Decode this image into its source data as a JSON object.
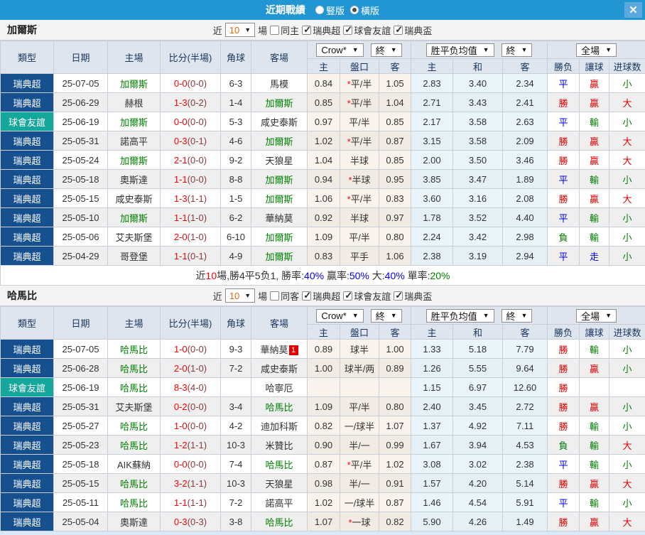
{
  "titlebar": {
    "title": "近期戰績",
    "radio_vertical": "豎版",
    "radio_horizontal": "橫版",
    "close_icon": "✕"
  },
  "colors": {
    "topbar": "#2196D3",
    "league_super": "#17508F",
    "league_friendly": "#16A79C",
    "win_red": "#E00000",
    "draw_blue": "#0000E0",
    "lose_green": "#008000",
    "score_red": "#FF0000",
    "half_maroon": "#8B3A3A",
    "odds_col_bg": "#FAF3EB",
    "avg_col_bg": "#E9F4FB",
    "header_bg": "#DFE5EF"
  },
  "columns": {
    "type": "類型",
    "date": "日期",
    "home": "主場",
    "score": "比分(半場)",
    "corners": "角球",
    "away": "客場",
    "odds_home": "主",
    "handicap": "盤口",
    "odds_away": "客",
    "avg_home": "主",
    "avg_draw": "和",
    "avg_away": "客",
    "result": "勝负",
    "handicap_result": "讓球",
    "goals": "进球数"
  },
  "dropdowns": {
    "company": "Crow*",
    "final1": "終",
    "avg": "胜平负均值",
    "final2": "終",
    "scope": "全場",
    "caret": "▼"
  },
  "sections": [
    {
      "team": "加爾斯",
      "filter": {
        "near_label": "近",
        "count": "10",
        "matches_label": "場",
        "same_label": "同主",
        "leagues": [
          {
            "label": "瑞典超"
          },
          {
            "label": "球會友誼"
          },
          {
            "label": "瑞典盃"
          }
        ]
      },
      "rows": [
        {
          "league": "瑞典超",
          "league_type": "super",
          "date": "25-07-05",
          "home": "加爾斯",
          "home_green": true,
          "score": "0-0",
          "half": "(0-0)",
          "corners": "6-3",
          "away": "馬模",
          "away_green": false,
          "odds_home": "0.84",
          "handicap_star": true,
          "handicap": "平/半",
          "odds_away": "1.05",
          "avg_home": "2.83",
          "avg_draw": "3.40",
          "avg_away": "2.34",
          "result": "平",
          "result_c": "blue",
          "hres": "贏",
          "hres_c": "red",
          "goals": "小",
          "goals_c": "green"
        },
        {
          "league": "瑞典超",
          "league_type": "super",
          "date": "25-06-29",
          "home": "赫根",
          "home_green": false,
          "score": "1-3",
          "half": "(0-2)",
          "corners": "1-4",
          "away": "加爾斯",
          "away_green": true,
          "odds_home": "0.85",
          "handicap_star": true,
          "handicap": "平/半",
          "odds_away": "1.04",
          "avg_home": "2.71",
          "avg_draw": "3.43",
          "avg_away": "2.41",
          "result": "勝",
          "result_c": "red",
          "hres": "贏",
          "hres_c": "red",
          "goals": "大",
          "goals_c": "red"
        },
        {
          "league": "球會友誼",
          "league_type": "friendly",
          "date": "25-06-19",
          "home": "加爾斯",
          "home_green": true,
          "score": "0-0",
          "half": "(0-0)",
          "corners": "5-3",
          "away": "咸史泰斯",
          "away_green": false,
          "odds_home": "0.97",
          "handicap_star": false,
          "handicap": "平/半",
          "odds_away": "0.85",
          "avg_home": "2.17",
          "avg_draw": "3.58",
          "avg_away": "2.63",
          "result": "平",
          "result_c": "blue",
          "hres": "輸",
          "hres_c": "green",
          "goals": "小",
          "goals_c": "green"
        },
        {
          "league": "瑞典超",
          "league_type": "super",
          "date": "25-05-31",
          "home": "諾高平",
          "home_green": false,
          "score": "0-3",
          "half": "(0-1)",
          "corners": "4-6",
          "away": "加爾斯",
          "away_green": true,
          "odds_home": "1.02",
          "handicap_star": true,
          "handicap": "平/半",
          "odds_away": "0.87",
          "avg_home": "3.15",
          "avg_draw": "3.58",
          "avg_away": "2.09",
          "result": "勝",
          "result_c": "red",
          "hres": "贏",
          "hres_c": "red",
          "goals": "大",
          "goals_c": "red"
        },
        {
          "league": "瑞典超",
          "league_type": "super",
          "date": "25-05-24",
          "home": "加爾斯",
          "home_green": true,
          "score": "2-1",
          "half": "(0-0)",
          "corners": "9-2",
          "away": "天狼星",
          "away_green": false,
          "odds_home": "1.04",
          "handicap_star": false,
          "handicap": "半球",
          "odds_away": "0.85",
          "avg_home": "2.00",
          "avg_draw": "3.50",
          "avg_away": "3.46",
          "result": "勝",
          "result_c": "red",
          "hres": "贏",
          "hres_c": "red",
          "goals": "大",
          "goals_c": "red"
        },
        {
          "league": "瑞典超",
          "league_type": "super",
          "date": "25-05-18",
          "home": "奧斯達",
          "home_green": false,
          "score": "1-1",
          "half": "(0-0)",
          "corners": "8-8",
          "away": "加爾斯",
          "away_green": true,
          "odds_home": "0.94",
          "handicap_star": true,
          "handicap": "半球",
          "odds_away": "0.95",
          "avg_home": "3.85",
          "avg_draw": "3.47",
          "avg_away": "1.89",
          "result": "平",
          "result_c": "blue",
          "hres": "輸",
          "hres_c": "green",
          "goals": "小",
          "goals_c": "green"
        },
        {
          "league": "瑞典超",
          "league_type": "super",
          "date": "25-05-15",
          "home": "咸史泰斯",
          "home_green": false,
          "score": "1-3",
          "half": "(1-1)",
          "corners": "1-5",
          "away": "加爾斯",
          "away_green": true,
          "odds_home": "1.06",
          "handicap_star": true,
          "handicap": "平/半",
          "odds_away": "0.83",
          "avg_home": "3.60",
          "avg_draw": "3.16",
          "avg_away": "2.08",
          "result": "勝",
          "result_c": "red",
          "hres": "贏",
          "hres_c": "red",
          "goals": "大",
          "goals_c": "red"
        },
        {
          "league": "瑞典超",
          "league_type": "super",
          "date": "25-05-10",
          "home": "加爾斯",
          "home_green": true,
          "score": "1-1",
          "half": "(1-0)",
          "corners": "6-2",
          "away": "華納莫",
          "away_green": false,
          "odds_home": "0.92",
          "handicap_star": false,
          "handicap": "半球",
          "odds_away": "0.97",
          "avg_home": "1.78",
          "avg_draw": "3.52",
          "avg_away": "4.40",
          "result": "平",
          "result_c": "blue",
          "hres": "輸",
          "hres_c": "green",
          "goals": "小",
          "goals_c": "green"
        },
        {
          "league": "瑞典超",
          "league_type": "super",
          "date": "25-05-06",
          "home": "艾夫斯堡",
          "home_green": false,
          "score": "2-0",
          "half": "(1-0)",
          "corners": "6-10",
          "away": "加爾斯",
          "away_green": true,
          "odds_home": "1.09",
          "handicap_star": false,
          "handicap": "平/半",
          "odds_away": "0.80",
          "avg_home": "2.24",
          "avg_draw": "3.42",
          "avg_away": "2.98",
          "result": "負",
          "result_c": "green",
          "hres": "輸",
          "hres_c": "green",
          "goals": "小",
          "goals_c": "green"
        },
        {
          "league": "瑞典超",
          "league_type": "super",
          "date": "25-04-29",
          "home": "哥登堡",
          "home_green": false,
          "score": "1-1",
          "half": "(0-1)",
          "corners": "4-9",
          "away": "加爾斯",
          "away_green": true,
          "odds_home": "0.83",
          "handicap_star": false,
          "handicap": "平手",
          "odds_away": "1.06",
          "avg_home": "2.38",
          "avg_draw": "3.19",
          "avg_away": "2.94",
          "result": "平",
          "result_c": "blue",
          "hres": "走",
          "hres_c": "blue",
          "goals": "小",
          "goals_c": "green"
        }
      ],
      "summary_parts": [
        {
          "text": "近",
          "color": "#333333"
        },
        {
          "text": "10",
          "color": "#FF0000"
        },
        {
          "text": "場,勝4平5负1, 勝率:",
          "color": "#333333"
        },
        {
          "text": "40%",
          "color": "#0000FF"
        },
        {
          "text": " 贏率:",
          "color": "#333333"
        },
        {
          "text": "50%",
          "color": "#0000FF"
        },
        {
          "text": " 大:",
          "color": "#333333"
        },
        {
          "text": "40%",
          "color": "#0000FF"
        },
        {
          "text": " 單率:",
          "color": "#333333"
        },
        {
          "text": "20%",
          "color": "#008000"
        }
      ]
    },
    {
      "team": "哈馬比",
      "filter": {
        "near_label": "近",
        "count": "10",
        "matches_label": "場",
        "same_label": "同客",
        "leagues": [
          {
            "label": "瑞典超"
          },
          {
            "label": "球會友誼"
          },
          {
            "label": "瑞典盃"
          }
        ]
      },
      "rows": [
        {
          "league": "瑞典超",
          "league_type": "super",
          "date": "25-07-05",
          "home": "哈馬比",
          "home_green": true,
          "score": "1-0",
          "half": "(0-0)",
          "corners": "9-3",
          "away": "華納莫",
          "away_green": false,
          "away_badge": "1",
          "odds_home": "0.89",
          "handicap_star": false,
          "handicap": "球半",
          "odds_away": "1.00",
          "avg_home": "1.33",
          "avg_draw": "5.18",
          "avg_away": "7.79",
          "result": "勝",
          "result_c": "red",
          "hres": "輸",
          "hres_c": "green",
          "goals": "小",
          "goals_c": "green"
        },
        {
          "league": "瑞典超",
          "league_type": "super",
          "date": "25-06-28",
          "home": "哈馬比",
          "home_green": true,
          "score": "2-0",
          "half": "(1-0)",
          "corners": "7-2",
          "away": "咸史泰斯",
          "away_green": false,
          "odds_home": "1.00",
          "handicap_star": false,
          "handicap": "球半/两",
          "odds_away": "0.89",
          "avg_home": "1.26",
          "avg_draw": "5.55",
          "avg_away": "9.64",
          "result": "勝",
          "result_c": "red",
          "hres": "贏",
          "hres_c": "red",
          "goals": "小",
          "goals_c": "green"
        },
        {
          "league": "球會友誼",
          "league_type": "friendly",
          "date": "25-06-19",
          "home": "哈馬比",
          "home_green": true,
          "score": "8-3",
          "half": "(4-0)",
          "corners": "",
          "away": "哈寧厄",
          "away_green": false,
          "odds_home": "",
          "handicap_star": false,
          "handicap": "",
          "odds_away": "",
          "avg_home": "1.15",
          "avg_draw": "6.97",
          "avg_away": "12.60",
          "result": "勝",
          "result_c": "red",
          "hres": "",
          "hres_c": "red",
          "goals": "",
          "goals_c": "green"
        },
        {
          "league": "瑞典超",
          "league_type": "super",
          "date": "25-05-31",
          "home": "艾夫斯堡",
          "home_green": false,
          "score": "0-2",
          "half": "(0-0)",
          "corners": "3-4",
          "away": "哈馬比",
          "away_green": true,
          "odds_home": "1.09",
          "handicap_star": false,
          "handicap": "平/半",
          "odds_away": "0.80",
          "avg_home": "2.40",
          "avg_draw": "3.45",
          "avg_away": "2.72",
          "result": "勝",
          "result_c": "red",
          "hres": "贏",
          "hres_c": "red",
          "goals": "小",
          "goals_c": "green"
        },
        {
          "league": "瑞典超",
          "league_type": "super",
          "date": "25-05-27",
          "home": "哈馬比",
          "home_green": true,
          "score": "1-0",
          "half": "(0-0)",
          "corners": "4-2",
          "away": "迪加科斯",
          "away_green": false,
          "odds_home": "0.82",
          "handicap_star": false,
          "handicap": "一/球半",
          "odds_away": "1.07",
          "avg_home": "1.37",
          "avg_draw": "4.92",
          "avg_away": "7.11",
          "result": "勝",
          "result_c": "red",
          "hres": "輸",
          "hres_c": "green",
          "goals": "小",
          "goals_c": "green"
        },
        {
          "league": "瑞典超",
          "league_type": "super",
          "date": "25-05-23",
          "home": "哈馬比",
          "home_green": true,
          "score": "1-2",
          "half": "(1-1)",
          "corners": "10-3",
          "away": "米贊比",
          "away_green": false,
          "odds_home": "0.90",
          "handicap_star": false,
          "handicap": "半/一",
          "odds_away": "0.99",
          "avg_home": "1.67",
          "avg_draw": "3.94",
          "avg_away": "4.53",
          "result": "負",
          "result_c": "green",
          "hres": "輸",
          "hres_c": "green",
          "goals": "大",
          "goals_c": "red"
        },
        {
          "league": "瑞典超",
          "league_type": "super",
          "date": "25-05-18",
          "home": "AIK蘇納",
          "home_green": false,
          "score": "0-0",
          "half": "(0-0)",
          "corners": "7-4",
          "away": "哈馬比",
          "away_green": true,
          "odds_home": "0.87",
          "handicap_star": true,
          "handicap": "平/半",
          "odds_away": "1.02",
          "avg_home": "3.08",
          "avg_draw": "3.02",
          "avg_away": "2.38",
          "result": "平",
          "result_c": "blue",
          "hres": "輸",
          "hres_c": "green",
          "goals": "小",
          "goals_c": "green"
        },
        {
          "league": "瑞典超",
          "league_type": "super",
          "date": "25-05-15",
          "home": "哈馬比",
          "home_green": true,
          "score": "3-2",
          "half": "(1-1)",
          "corners": "10-3",
          "away": "天狼星",
          "away_green": false,
          "odds_home": "0.98",
          "handicap_star": false,
          "handicap": "半/一",
          "odds_away": "0.91",
          "avg_home": "1.57",
          "avg_draw": "4.20",
          "avg_away": "5.14",
          "result": "勝",
          "result_c": "red",
          "hres": "贏",
          "hres_c": "red",
          "goals": "大",
          "goals_c": "red"
        },
        {
          "league": "瑞典超",
          "league_type": "super",
          "date": "25-05-11",
          "home": "哈馬比",
          "home_green": true,
          "score": "1-1",
          "half": "(1-1)",
          "corners": "7-2",
          "away": "諾高平",
          "away_green": false,
          "odds_home": "1.02",
          "handicap_star": false,
          "handicap": "一/球半",
          "odds_away": "0.87",
          "avg_home": "1.46",
          "avg_draw": "4.54",
          "avg_away": "5.91",
          "result": "平",
          "result_c": "blue",
          "hres": "輸",
          "hres_c": "green",
          "goals": "小",
          "goals_c": "green"
        },
        {
          "league": "瑞典超",
          "league_type": "super",
          "date": "25-05-04",
          "home": "奧斯達",
          "home_green": false,
          "score": "0-3",
          "half": "(0-3)",
          "corners": "3-8",
          "away": "哈馬比",
          "away_green": true,
          "odds_home": "1.07",
          "handicap_star": true,
          "handicap": "一球",
          "odds_away": "0.82",
          "avg_home": "5.90",
          "avg_draw": "4.26",
          "avg_away": "1.49",
          "result": "勝",
          "result_c": "red",
          "hres": "贏",
          "hres_c": "red",
          "goals": "大",
          "goals_c": "red"
        }
      ]
    }
  ]
}
